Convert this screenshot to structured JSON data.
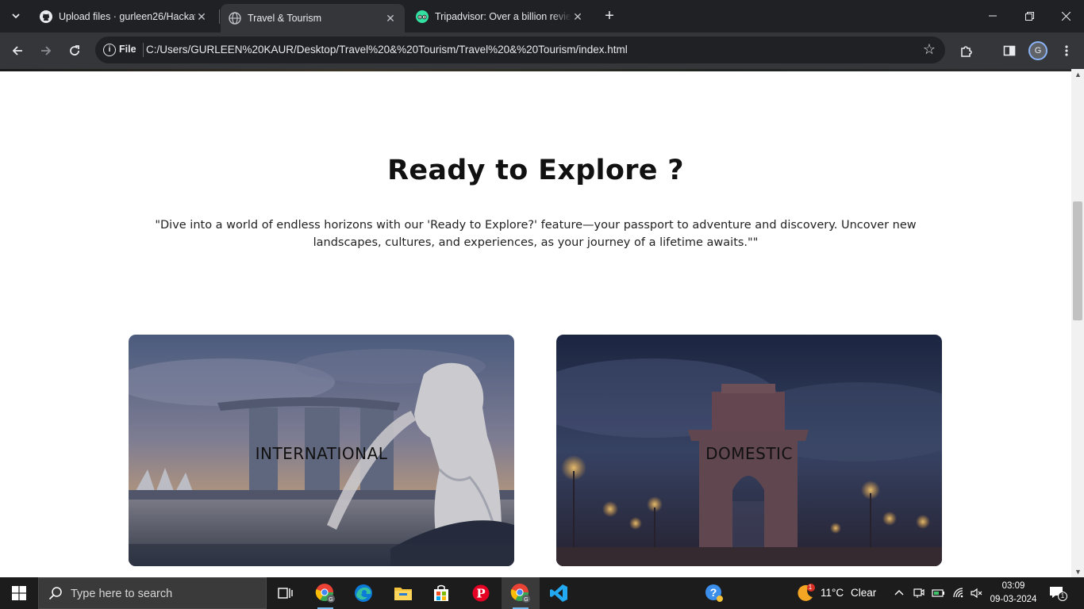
{
  "browser": {
    "tabs": [
      {
        "title": "Upload files · gurleen26/Hackat",
        "icon": "github-icon",
        "active": false
      },
      {
        "title": "Travel & Tourism",
        "icon": "globe-icon",
        "active": true
      },
      {
        "title": "Tripadvisor: Over a billion review",
        "icon": "tripadvisor-icon",
        "active": false
      }
    ],
    "address": {
      "scheme_label": "File",
      "url": "C:/Users/GURLEEN%20KAUR/Desktop/Travel%20&%20Tourism/Travel%20&%20Tourism/index.html"
    },
    "profile_initial": "G"
  },
  "page": {
    "heading": "Ready to Explore ?",
    "lead": "\"Dive into a world of endless horizons with our 'Ready to Explore?' feature—your passport to adventure and discovery. Uncover new landscapes, cultures, and experiences, as your journey of a lifetime awaits.\"\"",
    "cards": [
      {
        "label": "INTERNATIONAL",
        "image": "singapore-marina-bay-merlion"
      },
      {
        "label": "DOMESTIC",
        "image": "india-gate-dusk"
      }
    ]
  },
  "taskbar": {
    "search_placeholder": "Type here to search",
    "weather": {
      "temp": "11°C",
      "condition": "Clear",
      "badge": "1"
    },
    "clock": {
      "time": "03:09",
      "date": "09-03-2024"
    },
    "notification_count": "1"
  },
  "colors": {
    "chrome_dark": "#202124",
    "chrome_toolbar": "#35363a",
    "taskbar": "#1c1c1c",
    "accent": "#8ab4f8"
  }
}
